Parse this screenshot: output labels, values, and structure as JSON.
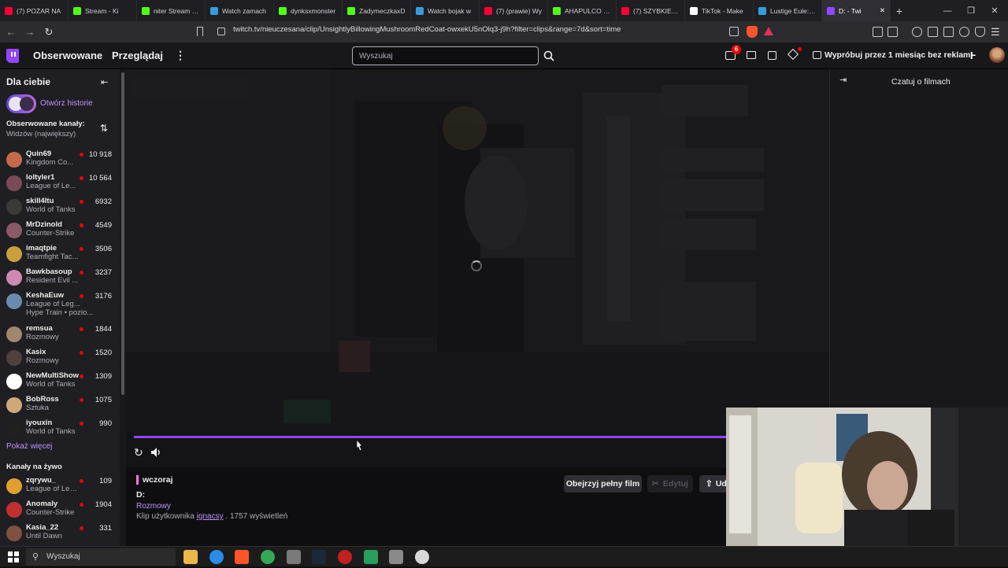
{
  "browser": {
    "tabs": [
      {
        "title": "(7) POŻAR NA",
        "color": "#ff0033"
      },
      {
        "title": "Stream - Ki",
        "color": "#53fc18"
      },
      {
        "title": "niter Stream - V",
        "color": "#53fc18"
      },
      {
        "title": "Watch zamach",
        "color": "#3a9bdc"
      },
      {
        "title": "dynksxmonster",
        "color": "#53fc18"
      },
      {
        "title": "ZadymeczkaxD",
        "color": "#53fc18"
      },
      {
        "title": "Watch bojak w",
        "color": "#3a9bdc"
      },
      {
        "title": "(7) (prawie) Wy",
        "color": "#ff0033"
      },
      {
        "title": "AHAPULCO clip",
        "color": "#53fc18"
      },
      {
        "title": "(7) SZYBKIE PY",
        "color": "#ff0033"
      },
      {
        "title": "TikTok - Make",
        "color": "#ffffff"
      },
      {
        "title": "Lustige Eule: Sp",
        "color": "#3a9bdc"
      },
      {
        "title": "D: - Twi",
        "color": "#9147ff",
        "active": true
      }
    ],
    "new_tab": "+",
    "url": "twitch.tv/nieuczesana/clip/UnsightlyBillowingMushroomRedCoat-owxekU5nOlq3-j9h?filter=clips&range=7d&sort=time"
  },
  "topnav": {
    "following": "Obserwowane",
    "browse": "Przeglądaj",
    "search_placeholder": "Wyszukaj",
    "notif_count": "6",
    "promo": "Wypróbuj przez 1 miesiąc bez reklam"
  },
  "sidebar": {
    "for_you": "Dla ciebie",
    "stories": "Otwórz historie",
    "followed_title": "Obserwowane kanały:",
    "followed_sort": "Widzów (największy)",
    "show_more": "Pokaż więcej",
    "live_title": "Kanały na żywo",
    "followed": [
      {
        "name": "Quin69",
        "game": "Kingdom Co...",
        "viewers": "10 918",
        "color": "#c46a4a"
      },
      {
        "name": "loltyler1",
        "game": "League of Le...",
        "viewers": "10 564",
        "color": "#7a4a5a"
      },
      {
        "name": "skill4ltu",
        "game": "World of Tanks",
        "viewers": "6932",
        "color": "#3a3a3a"
      },
      {
        "name": "MrDzinold",
        "game": "Counter-Strike",
        "viewers": "4549",
        "color": "#8a5a6a"
      },
      {
        "name": "imaqtpie",
        "game": "Teamfight Tac...",
        "viewers": "3506",
        "color": "#c8a040"
      },
      {
        "name": "Bawkbasoup",
        "game": "Resident Evil ...",
        "viewers": "3237",
        "color": "#d08ab0"
      },
      {
        "name": "KeshaEuw",
        "game": "League of Leg...",
        "viewers": "3176",
        "color": "#6a8ab0",
        "extra": "Hype Train • pozio..."
      },
      {
        "name": "remsua",
        "game": "Rozmowy",
        "viewers": "1844",
        "color": "#a08870"
      },
      {
        "name": "Kasix",
        "game": "Rozmowy",
        "viewers": "1520",
        "color": "#504040"
      },
      {
        "name": "NewMultiShow",
        "game": "World of Tanks",
        "viewers": "1309",
        "color": "#ffffff"
      },
      {
        "name": "BobRoss",
        "game": "Sztuka",
        "viewers": "1075",
        "color": "#d0a878"
      },
      {
        "name": "iyouxin",
        "game": "World of Tanks",
        "viewers": "990",
        "color": "#202020"
      }
    ],
    "live": [
      {
        "name": "zqrywu_",
        "game": "League of Lege...",
        "viewers": "109",
        "color": "#e0a030"
      },
      {
        "name": "Anomaly",
        "game": "Counter-Strike",
        "viewers": "1904",
        "color": "#c03030"
      },
      {
        "name": "Kasia_22",
        "game": "Until Dawn",
        "viewers": "331",
        "color": "#805040"
      }
    ]
  },
  "player": {
    "progress": 1.0
  },
  "clip": {
    "date": "wczoraj",
    "title": "D:",
    "category": "Rozmowy",
    "by_prefix": "Klip użytkownika",
    "author": "ignacsy",
    "views": ". 1757 wyświetleń",
    "watch_full": "Obejrzyj pełny film",
    "edit": "Edytuj",
    "share": "Ud"
  },
  "chat": {
    "title": "Czatuj o filmach"
  },
  "taskbar": {
    "search": "Wyszukaj"
  }
}
